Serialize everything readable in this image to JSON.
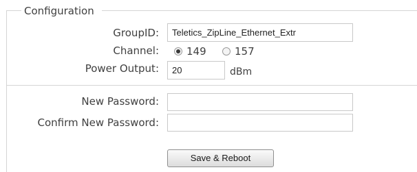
{
  "section": {
    "legend": "Configuration"
  },
  "group_id": {
    "label": "GroupID:",
    "value": "Teletics_ZipLine_Ethernet_Extr"
  },
  "channel": {
    "label": "Channel:",
    "options": [
      {
        "label": "149",
        "selected": true
      },
      {
        "label": "157",
        "selected": false
      }
    ]
  },
  "power_output": {
    "label": "Power Output:",
    "value": "20",
    "unit": "dBm"
  },
  "new_password": {
    "label": "New Password:",
    "value": ""
  },
  "confirm_password": {
    "label": "Confirm New Password:",
    "value": ""
  },
  "save_button": {
    "label": "Save & Reboot"
  }
}
